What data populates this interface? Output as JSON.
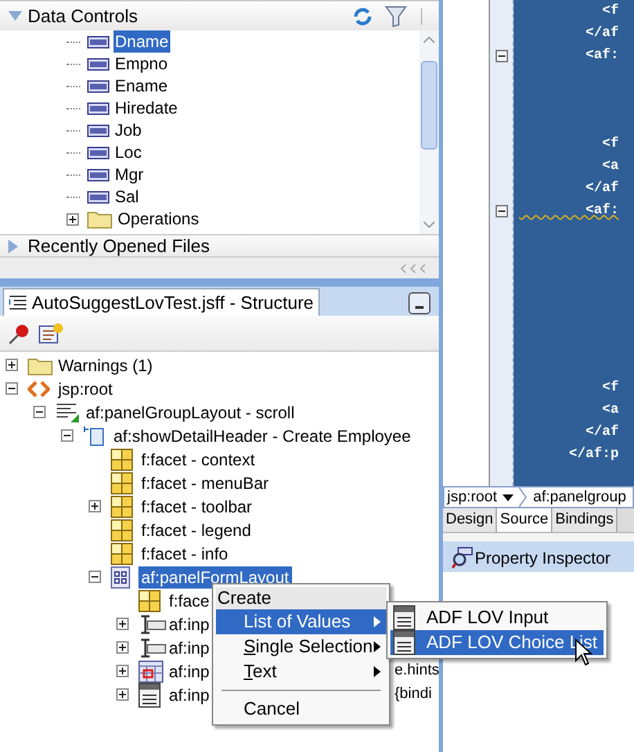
{
  "data_controls": {
    "title": "Data Controls",
    "expanded": true,
    "items": [
      {
        "kind": "attribute",
        "label": "Dname",
        "selected": true
      },
      {
        "kind": "attribute",
        "label": "Empno",
        "selected": false
      },
      {
        "kind": "attribute",
        "label": "Ename",
        "selected": false
      },
      {
        "kind": "attribute",
        "label": "Hiredate",
        "selected": false
      },
      {
        "kind": "attribute",
        "label": "Job",
        "selected": false
      },
      {
        "kind": "attribute",
        "label": "Loc",
        "selected": false
      },
      {
        "kind": "attribute",
        "label": "Mgr",
        "selected": false
      },
      {
        "kind": "attribute",
        "label": "Sal",
        "selected": false
      },
      {
        "kind": "folder",
        "label": "Operations",
        "selected": false,
        "expanded": false
      }
    ]
  },
  "recent_files": {
    "title": "Recently Opened Files",
    "expanded": false
  },
  "structure": {
    "tab": "AutoSuggestLovTest.jsff - Structure",
    "tree": [
      {
        "kind": "folder",
        "label": "Warnings (1)",
        "selected": false,
        "expanded": false
      },
      {
        "kind": "jsp",
        "label": "jsp:root",
        "selected": false,
        "expanded": true,
        "children": [
          {
            "kind": "group",
            "label": "af:panelGroupLayout - scroll",
            "selected": false,
            "expanded": true,
            "children": [
              {
                "kind": "header",
                "label": "af:showDetailHeader - Create Employee",
                "selected": false,
                "expanded": true,
                "children": [
                  {
                    "kind": "facet",
                    "label": "f:facet - context",
                    "selected": false
                  },
                  {
                    "kind": "facet",
                    "label": "f:facet - menuBar",
                    "selected": false
                  },
                  {
                    "kind": "facet",
                    "label": "f:facet - toolbar",
                    "selected": false,
                    "expanded": false
                  },
                  {
                    "kind": "facet",
                    "label": "f:facet - legend",
                    "selected": false
                  },
                  {
                    "kind": "facet",
                    "label": "f:facet - info",
                    "selected": false
                  },
                  {
                    "kind": "form",
                    "label": "af:panelFormLayout",
                    "selected": true,
                    "expanded": true,
                    "children": [
                      {
                        "kind": "facet",
                        "label": "f:face",
                        "selected": false
                      },
                      {
                        "kind": "input",
                        "label": "af:inp",
                        "selected": false,
                        "expanded": false
                      },
                      {
                        "kind": "input",
                        "label": "af:inp",
                        "selected": false,
                        "expanded": false
                      },
                      {
                        "kind": "date",
                        "label": "af:inp",
                        "trailing": "e.hints",
                        "selected": false,
                        "expanded": false
                      },
                      {
                        "kind": "choice",
                        "label": "af:inp",
                        "trailing": "{bindi",
                        "selected": false,
                        "expanded": false
                      }
                    ]
                  }
                ]
              }
            ]
          }
        ]
      }
    ]
  },
  "editor": {
    "lines": [
      {
        "kind": "code",
        "text": "          <f",
        "foldable": false,
        "warning": false
      },
      {
        "kind": "code",
        "text": "        </af",
        "foldable": false,
        "warning": false
      },
      {
        "kind": "code",
        "text": "        <af:",
        "foldable": true,
        "warning": false
      },
      {
        "kind": "blank"
      },
      {
        "kind": "blank"
      },
      {
        "kind": "blank"
      },
      {
        "kind": "code",
        "text": "          <f",
        "foldable": false,
        "warning": false
      },
      {
        "kind": "code",
        "text": "          <a",
        "foldable": false,
        "warning": false
      },
      {
        "kind": "code",
        "text": "        </af",
        "foldable": false,
        "warning": false
      },
      {
        "kind": "code",
        "text": "        <af:",
        "foldable": true,
        "warning": true
      },
      {
        "kind": "blank"
      },
      {
        "kind": "blank"
      },
      {
        "kind": "blank"
      },
      {
        "kind": "blank"
      },
      {
        "kind": "blank"
      },
      {
        "kind": "blank"
      },
      {
        "kind": "blank"
      },
      {
        "kind": "code",
        "text": "          <f",
        "foldable": false,
        "warning": false
      },
      {
        "kind": "code",
        "text": "          <a",
        "foldable": false,
        "warning": false
      },
      {
        "kind": "code",
        "text": "        </af",
        "foldable": false,
        "warning": false
      },
      {
        "kind": "code",
        "text": "      </af:p",
        "foldable": false,
        "warning": false
      }
    ],
    "breadcrumb": [
      "jsp:root",
      "af:panelgroup"
    ],
    "tabs": [
      {
        "label": "Design",
        "selected": false
      },
      {
        "label": "Source",
        "selected": true
      },
      {
        "label": "Bindings",
        "selected": false
      }
    ]
  },
  "property_inspector": {
    "tab": "Property Inspector"
  },
  "context_menu": {
    "items": [
      {
        "kind": "title",
        "label": "Create"
      },
      {
        "kind": "item",
        "label": "List of Values",
        "selected": true,
        "submenu": true,
        "mnemonic": false
      },
      {
        "kind": "item",
        "label": "Single Selection",
        "selected": false,
        "submenu": true,
        "mnemonic": true
      },
      {
        "kind": "item",
        "label": "Text",
        "selected": false,
        "submenu": true,
        "mnemonic": true
      },
      {
        "kind": "separator"
      },
      {
        "kind": "item",
        "label": "Cancel",
        "selected": false,
        "submenu": false,
        "mnemonic": false
      }
    ],
    "submenu": [
      {
        "label": "ADF LOV Input",
        "selected": false
      },
      {
        "label": "ADF LOV Choice List",
        "selected": true
      }
    ]
  }
}
